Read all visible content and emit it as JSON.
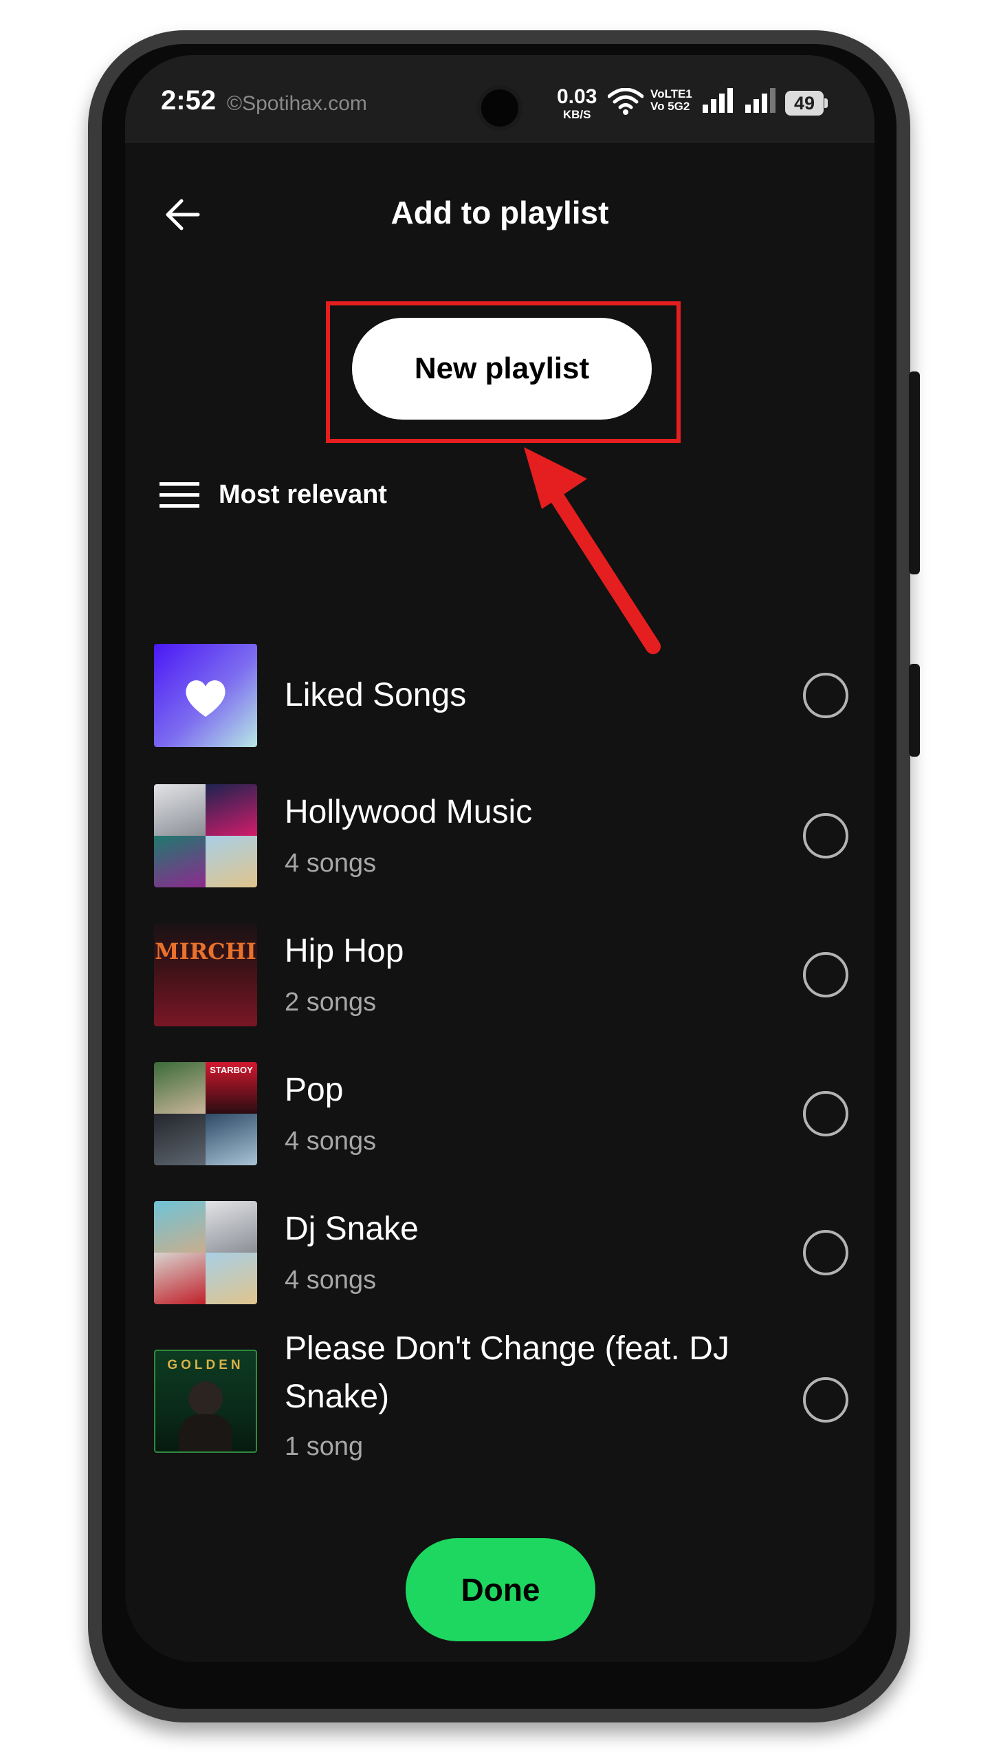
{
  "status_bar": {
    "time": "2:52",
    "watermark": "©Spotihax.com",
    "net_speed": "0.03",
    "net_unit": "KB/S",
    "volte_line1": "VoLTE1",
    "volte_line2": "Vo 5G2",
    "battery": "49"
  },
  "header": {
    "title": "Add to playlist"
  },
  "new_playlist_label": "New playlist",
  "sort": {
    "label": "Most relevant"
  },
  "playlists": [
    {
      "title": "Liked Songs",
      "subtitle": ""
    },
    {
      "title": "Hollywood Music",
      "subtitle": "4 songs"
    },
    {
      "title": "Hip Hop",
      "subtitle": "2 songs",
      "cover_text": "MIRCHI"
    },
    {
      "title": "Pop",
      "subtitle": "4 songs",
      "cover_text": "STARBOY"
    },
    {
      "title": "Dj Snake",
      "subtitle": "4 songs"
    },
    {
      "title": "Please Don't Change (feat. DJ Snake)",
      "subtitle": "1 song",
      "cover_text": "GOLDEN"
    }
  ],
  "done_label": "Done",
  "colors": {
    "background": "#121212",
    "primary_green": "#1ed760",
    "highlight_red": "#e51f1f",
    "text_secondary": "#a7a7a7"
  },
  "icons": [
    "back-arrow-icon",
    "wifi-icon",
    "signal-icon",
    "sort-lines-icon",
    "heart-icon",
    "radio-circle-icon"
  ]
}
